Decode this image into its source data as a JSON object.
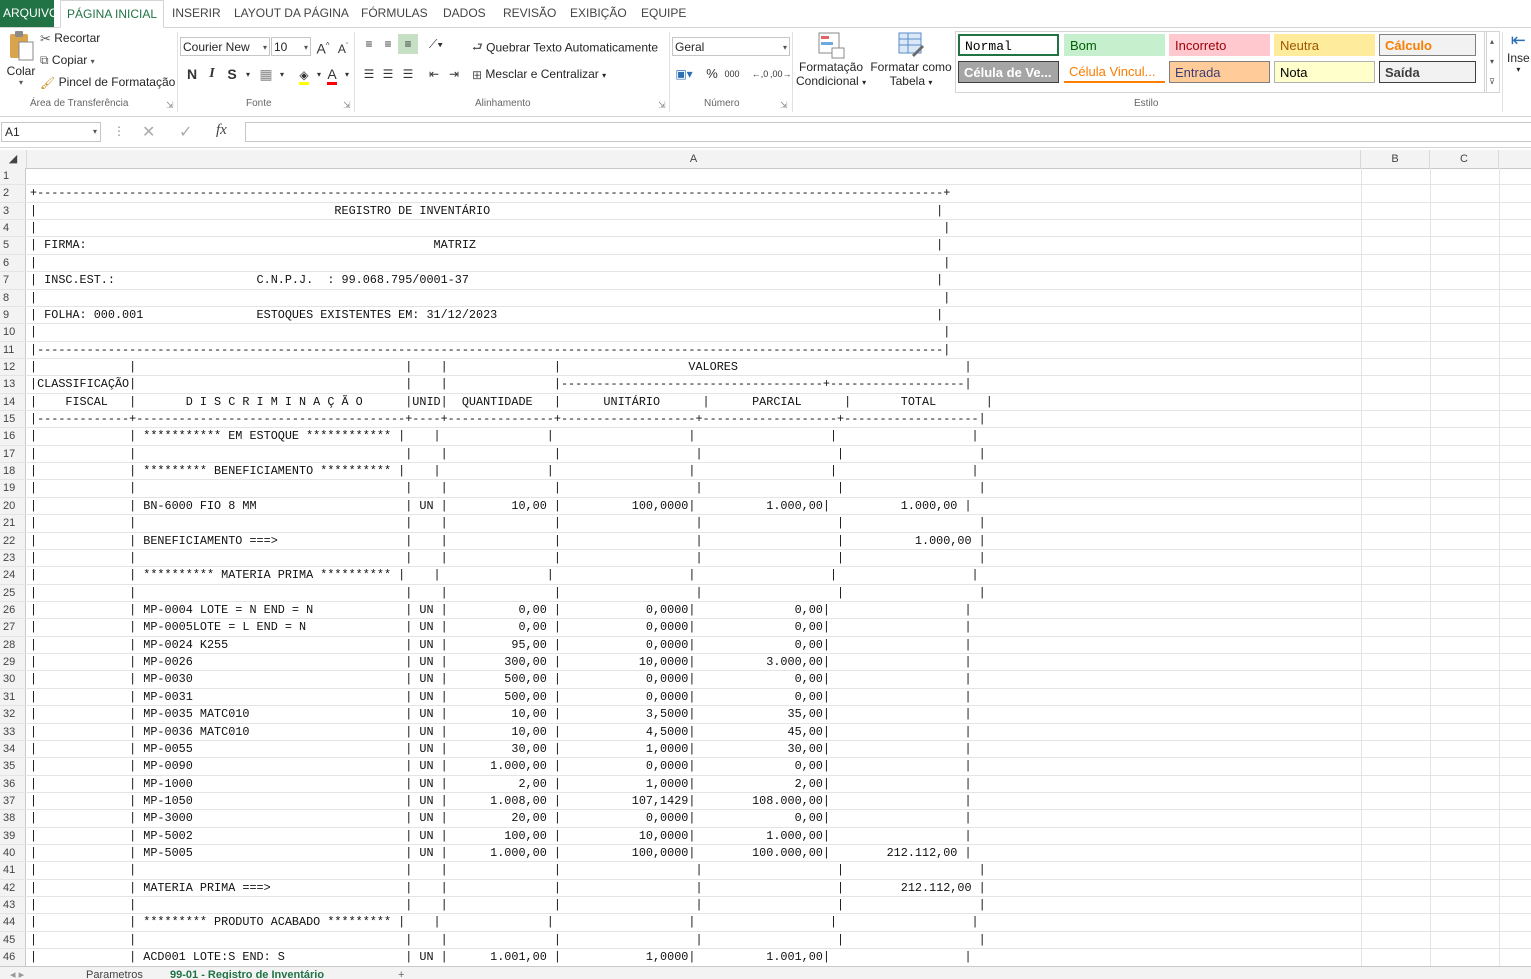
{
  "ribbon_tabs": {
    "file": "ARQUIVO",
    "home": "PÁGINA INICIAL",
    "insert": "INSERIR",
    "layout": "LAYOUT DA PÁGINA",
    "formulas": "FÓRMULAS",
    "data": "DADOS",
    "review": "REVISÃO",
    "view": "EXIBIÇÃO",
    "team": "EQUIPE"
  },
  "clipboard": {
    "paste": "Colar",
    "cut": "Recortar",
    "copy": "Copiar",
    "format_painter": "Pincel de Formatação",
    "group": "Área de Transferência"
  },
  "font": {
    "name": "Courier New",
    "size": "10",
    "bold": "N",
    "italic": "I",
    "underline": "S",
    "group": "Fonte"
  },
  "alignment": {
    "wrap": "Quebrar Texto Automaticamente",
    "merge": "Mesclar e Centralizar",
    "group": "Alinhamento"
  },
  "number": {
    "format": "Geral",
    "percent": "%",
    "thousands": "000",
    "group": "Número"
  },
  "styles": {
    "conditional_1": "Formatação",
    "conditional_2": "Condicional",
    "table_1": "Formatar como",
    "table_2": "Tabela",
    "group": "Estilo",
    "cells": [
      {
        "label": "Normal",
        "bg": "#ffffff",
        "fg": "#000000",
        "border": "#217346"
      },
      {
        "label": "Bom",
        "bg": "#c6efce",
        "fg": "#006100",
        "border": "#c6efce"
      },
      {
        "label": "Incorreto",
        "bg": "#ffc7ce",
        "fg": "#9c0006",
        "border": "#ffc7ce"
      },
      {
        "label": "Neutra",
        "bg": "#ffeb9c",
        "fg": "#9c5700",
        "border": "#ffeb9c"
      },
      {
        "label": "Cálculo",
        "bg": "#f2f2f2",
        "fg": "#fa7d00",
        "border": "#7f7f7f"
      },
      {
        "label": "Célula de Ve...",
        "bg": "#a5a5a5",
        "fg": "#ffffff",
        "border": "#3f3f3f"
      },
      {
        "label": "Célula Vincul...",
        "bg": "#ffffff",
        "fg": "#fa7d00",
        "border": "#ff8001"
      },
      {
        "label": "Entrada",
        "bg": "#ffcc99",
        "fg": "#3f3f76",
        "border": "#7f7f7f"
      },
      {
        "label": "Nota",
        "bg": "#ffffcc",
        "fg": "#000000",
        "border": "#b2b2b2"
      },
      {
        "label": "Saída",
        "bg": "#f2f2f2",
        "fg": "#3f3f3f",
        "border": "#3f3f3f"
      }
    ],
    "insert": "Inse"
  },
  "formula_bar": {
    "name_box": "A1",
    "fx": "fx",
    "content": ""
  },
  "columns": [
    "A",
    "B",
    "C"
  ],
  "rows": [
    {
      "n": "1",
      "t": ""
    },
    {
      "n": "2",
      "t": "+--------------------------------------------------------------------------------------------------------------------------------+"
    },
    {
      "n": "3",
      "t": "|                                          REGISTRO DE INVENTÁRIO                                                               |"
    },
    {
      "n": "4",
      "t": "|                                                                                                                                |"
    },
    {
      "n": "5",
      "t": "| FIRMA:                                                 MATRIZ                                                                 |"
    },
    {
      "n": "6",
      "t": "|                                                                                                                                |"
    },
    {
      "n": "7",
      "t": "| INSC.EST.:                    C.N.P.J.  : 99.068.795/0001-37                                                                  |"
    },
    {
      "n": "8",
      "t": "|                                                                                                                                |"
    },
    {
      "n": "9",
      "t": "| FOLHA: 000.001                ESTOQUES EXISTENTES EM: 31/12/2023                                                              |"
    },
    {
      "n": "10",
      "t": "|                                                                                                                                |"
    },
    {
      "n": "11",
      "t": "|--------------------------------------------------------------------------------------------------------------------------------|"
    },
    {
      "n": "12",
      "t": "|             |                                      |    |               |                  VALORES                                |"
    },
    {
      "n": "13",
      "t": "|CLASSIFICAÇÃO|                                      |    |               |-------------------------------------+-------------------|"
    },
    {
      "n": "14",
      "t": "|    FISCAL   |       D I S C R I M I N A Ç Ã O      |UNID|  QUANTIDADE   |      UNITÁRIO      |      PARCIAL      |       TOTAL       |"
    },
    {
      "n": "15",
      "t": "|-------------+--------------------------------------+----+---------------+-------------------+-------------------+-------------------|"
    },
    {
      "n": "16",
      "t": "|             | *********** EM ESTOQUE ************ |    |               |                   |                   |                   |"
    },
    {
      "n": "17",
      "t": "|             |                                      |    |               |                   |                   |                   |"
    },
    {
      "n": "18",
      "t": "|             | ********* BENEFICIAMENTO ********** |    |               |                   |                   |                   |"
    },
    {
      "n": "19",
      "t": "|             |                                      |    |               |                   |                   |                   |"
    },
    {
      "n": "20",
      "t": "|             | BN-6000 FIO 8 MM                     | UN |         10,00 |          100,0000|          1.000,00|          1.000,00 |"
    },
    {
      "n": "21",
      "t": "|             |                                      |    |               |                   |                   |                   |"
    },
    {
      "n": "22",
      "t": "|             | BENEFICIAMENTO ===>                  |    |               |                   |                   |          1.000,00 |"
    },
    {
      "n": "23",
      "t": "|             |                                      |    |               |                   |                   |                   |"
    },
    {
      "n": "24",
      "t": "|             | ********** MATERIA PRIMA ********** |    |               |                   |                   |                   |"
    },
    {
      "n": "25",
      "t": "|             |                                      |    |               |                   |                   |                   |"
    },
    {
      "n": "26",
      "t": "|             | MP-0004 LOTE = N END = N             | UN |          0,00 |            0,0000|              0,00|                   |"
    },
    {
      "n": "27",
      "t": "|             | MP-0005LOTE = L END = N              | UN |          0,00 |            0,0000|              0,00|                   |"
    },
    {
      "n": "28",
      "t": "|             | MP-0024 K255                         | UN |         95,00 |            0,0000|              0,00|                   |"
    },
    {
      "n": "29",
      "t": "|             | MP-0026                              | UN |        300,00 |           10,0000|          3.000,00|                   |"
    },
    {
      "n": "30",
      "t": "|             | MP-0030                              | UN |        500,00 |            0,0000|              0,00|                   |"
    },
    {
      "n": "31",
      "t": "|             | MP-0031                              | UN |        500,00 |            0,0000|              0,00|                   |"
    },
    {
      "n": "32",
      "t": "|             | MP-0035 MATC010                      | UN |         10,00 |            3,5000|             35,00|                   |"
    },
    {
      "n": "33",
      "t": "|             | MP-0036 MATC010                      | UN |         10,00 |            4,5000|             45,00|                   |"
    },
    {
      "n": "34",
      "t": "|             | MP-0055                              | UN |         30,00 |            1,0000|             30,00|                   |"
    },
    {
      "n": "35",
      "t": "|             | MP-0090                              | UN |      1.000,00 |            0,0000|              0,00|                   |"
    },
    {
      "n": "36",
      "t": "|             | MP-1000                              | UN |          2,00 |            1,0000|              2,00|                   |"
    },
    {
      "n": "37",
      "t": "|             | MP-1050                              | UN |      1.008,00 |          107,1429|        108.000,00|                   |"
    },
    {
      "n": "38",
      "t": "|             | MP-3000                              | UN |         20,00 |            0,0000|              0,00|                   |"
    },
    {
      "n": "39",
      "t": "|             | MP-5002                              | UN |        100,00 |           10,0000|          1.000,00|                   |"
    },
    {
      "n": "40",
      "t": "|             | MP-5005                              | UN |      1.000,00 |          100,0000|        100.000,00|        212.112,00 |"
    },
    {
      "n": "41",
      "t": "|             |                                      |    |               |                   |                   |                   |"
    },
    {
      "n": "42",
      "t": "|             | MATERIA PRIMA ===>                   |    |               |                   |                   |        212.112,00 |"
    },
    {
      "n": "43",
      "t": "|             |                                      |    |               |                   |                   |                   |"
    },
    {
      "n": "44",
      "t": "|             | ********* PRODUTO ACABADO ********* |    |               |                   |                   |                   |"
    },
    {
      "n": "45",
      "t": "|             |                                      |    |               |                   |                   |                   |"
    },
    {
      "n": "46",
      "t": "|             | ACD001 LOTE:S END: S                 | UN |      1.001,00 |            1,0000|          1.001,00|                   |"
    }
  ],
  "sheet_tabs": {
    "tab1": "Parametros",
    "tab2": "99-01 - Registro de Inventário",
    "add": "+"
  }
}
